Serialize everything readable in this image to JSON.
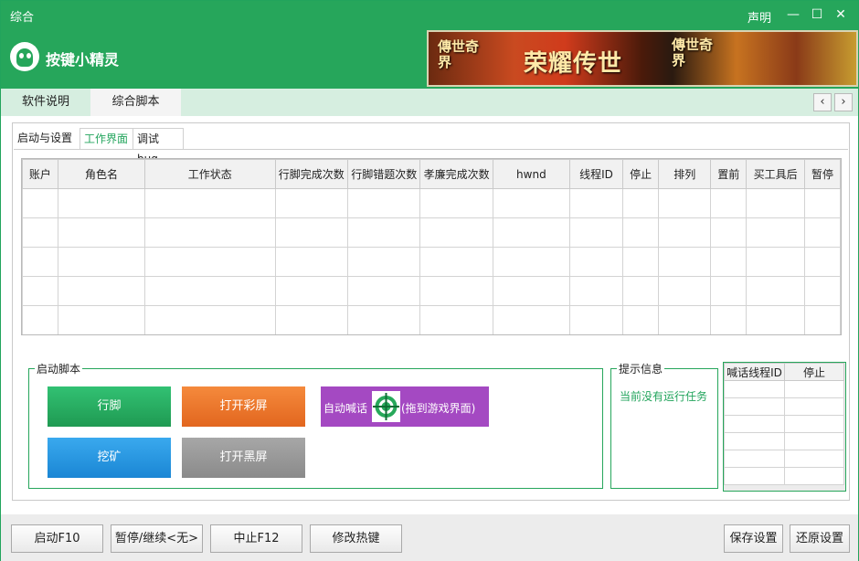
{
  "window": {
    "title": "综合",
    "declare_label": "声明",
    "controls": {
      "minimize": "—",
      "maximize": "☐",
      "close": "✕"
    },
    "brand": "按键小精灵",
    "banner": {
      "left_logo": "傳世奇界",
      "slogan": "荣耀传世",
      "right_logo": "傳世奇界"
    }
  },
  "top_tabs": [
    "软件说明",
    "综合脚本"
  ],
  "nav": {
    "prev": "‹",
    "next": "›"
  },
  "sub_tabs": [
    "启动与设置",
    "工作界面",
    "调试bug"
  ],
  "grid": {
    "columns": [
      "账户",
      "角色名",
      "工作状态",
      "行脚完成次数",
      "行脚错题次数",
      "孝廉完成次数",
      "hwnd",
      "线程ID",
      "停止",
      "排列",
      "置前",
      "买工具后",
      "暂停"
    ],
    "row_count": 5
  },
  "start_group": {
    "legend": "启动脚本",
    "buttons": {
      "walk": "行脚",
      "open_color": "打开彩屏",
      "mine": "挖矿",
      "open_black": "打开黑屏"
    },
    "shout_label": "自动喊话",
    "shout_hint": "(拖到游戏界面)"
  },
  "info_group": {
    "legend": "提示信息",
    "text": "当前没有运行任务"
  },
  "mini_grid": {
    "columns": [
      "喊话线程ID",
      "停止"
    ],
    "row_count": 6
  },
  "bottom": {
    "start": "启动F10",
    "pause": "暂停/继续<无>",
    "stop": "中止F12",
    "hotkey": "修改热键",
    "save": "保存设置",
    "restore": "还原设置"
  },
  "colors": {
    "brand_green": "#26a65b",
    "accent_purple": "#a449c2",
    "accent_orange": "#e2661f",
    "accent_blue": "#1a86d4"
  }
}
